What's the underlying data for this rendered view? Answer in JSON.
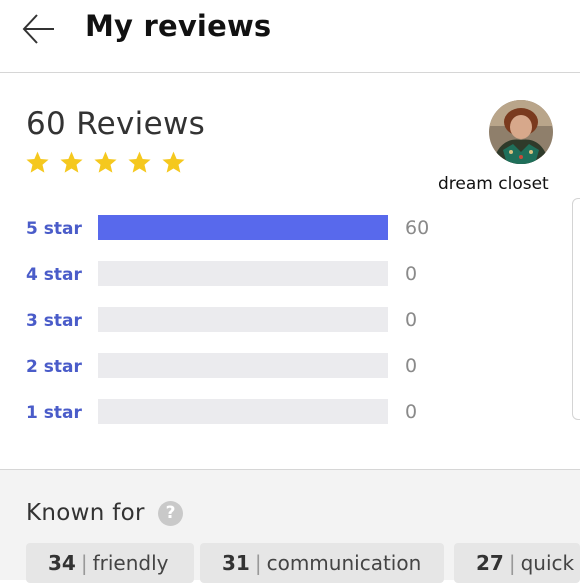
{
  "header": {
    "title": "My reviews"
  },
  "summary": {
    "title": "60 Reviews",
    "rating_stars": 5,
    "star_color": "#f5c81e"
  },
  "profile": {
    "name": "dream closet"
  },
  "ratings": [
    {
      "label": "5 star",
      "count": "60",
      "fraction": 1.0
    },
    {
      "label": "4 star",
      "count": "0",
      "fraction": 0
    },
    {
      "label": "3 star",
      "count": "0",
      "fraction": 0
    },
    {
      "label": "2 star",
      "count": "0",
      "fraction": 0
    },
    {
      "label": "1 star",
      "count": "0",
      "fraction": 0
    }
  ],
  "known_for": {
    "title": "Known for",
    "help_glyph": "?",
    "tags": [
      {
        "count": "34",
        "label": "friendly"
      },
      {
        "count": "31",
        "label": "communication"
      },
      {
        "count": "27",
        "label": "quick s"
      }
    ]
  },
  "colors": {
    "accent": "#5869ec",
    "label": "#4a5cc9",
    "track": "#ebebee"
  }
}
